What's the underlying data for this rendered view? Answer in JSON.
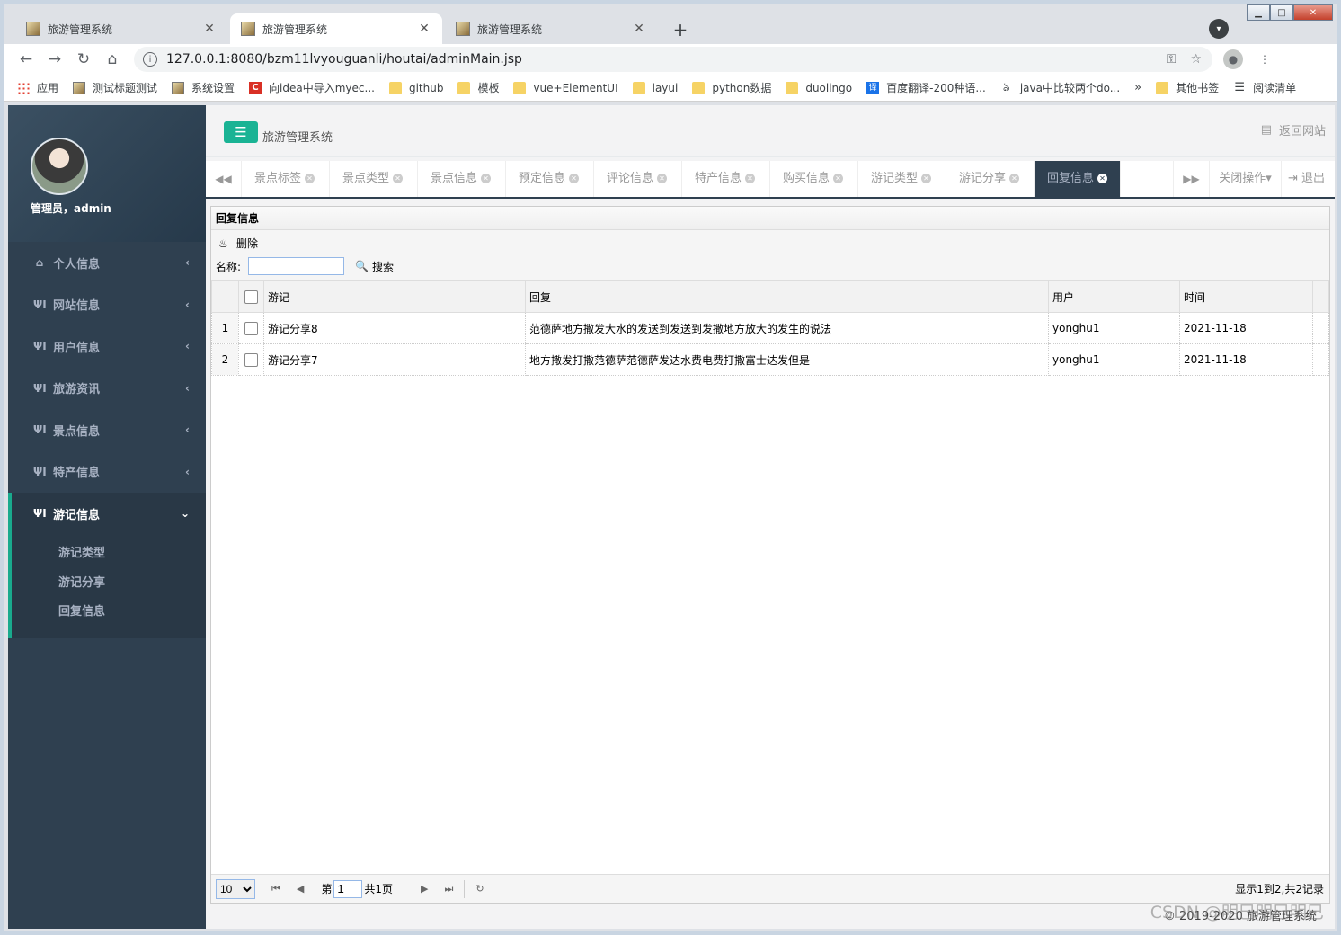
{
  "browser": {
    "tabs": [
      {
        "title": "旅游管理系统",
        "active": false
      },
      {
        "title": "旅游管理系统",
        "active": true
      },
      {
        "title": "旅游管理系统",
        "active": false
      }
    ],
    "url": "127.0.0.1:8080/bzm11lvyouguanli/houtai/adminMain.jsp",
    "bookmarks": [
      {
        "label": "应用",
        "icon": "apps-icon"
      },
      {
        "label": "测试标题测试",
        "icon": "page-icon"
      },
      {
        "label": "系统设置",
        "icon": "page-icon"
      },
      {
        "label": "向idea中导入myec...",
        "icon": "red-c-icon"
      },
      {
        "label": "github",
        "icon": "folder-icon"
      },
      {
        "label": "模板",
        "icon": "folder-icon"
      },
      {
        "label": "vue+ElementUI",
        "icon": "folder-icon"
      },
      {
        "label": "layui",
        "icon": "folder-icon"
      },
      {
        "label": "python数据",
        "icon": "folder-icon"
      },
      {
        "label": "duolingo",
        "icon": "folder-icon"
      },
      {
        "label": "百度翻译-200种语...",
        "icon": "translate-icon"
      },
      {
        "label": "java中比较两个do...",
        "icon": "link-icon"
      }
    ],
    "bookmarks_more": "»",
    "other_bookmarks": "其他书签",
    "reading_list": "阅读清单"
  },
  "sidebar": {
    "user": "管理员，admin",
    "menu": [
      {
        "label": "个人信息",
        "icon": "home-icon"
      },
      {
        "label": "网站信息",
        "icon": "cutlery-icon"
      },
      {
        "label": "用户信息",
        "icon": "cutlery-icon"
      },
      {
        "label": "旅游资讯",
        "icon": "cutlery-icon"
      },
      {
        "label": "景点信息",
        "icon": "cutlery-icon"
      },
      {
        "label": "特产信息",
        "icon": "cutlery-icon"
      },
      {
        "label": "游记信息",
        "icon": "cutlery-icon",
        "open": true
      }
    ],
    "submenu": [
      "游记类型",
      "游记分享",
      "回复信息"
    ]
  },
  "header": {
    "system_title": "旅游管理系统",
    "back_to_site": "返回网站"
  },
  "content_tabs": [
    {
      "label": "景点标签"
    },
    {
      "label": "景点类型"
    },
    {
      "label": "景点信息"
    },
    {
      "label": "预定信息"
    },
    {
      "label": "评论信息"
    },
    {
      "label": "特产信息"
    },
    {
      "label": "购买信息"
    },
    {
      "label": "游记类型"
    },
    {
      "label": "游记分享"
    },
    {
      "label": "回复信息",
      "active": true
    }
  ],
  "tab_actions": {
    "close_ops": "关闭操作",
    "logout": "退出"
  },
  "panel": {
    "title": "回复信息",
    "delete_label": "删除",
    "name_label": "名称:",
    "name_value": "",
    "search_label": "搜索"
  },
  "table": {
    "columns": [
      "游记",
      "回复",
      "用户",
      "时间"
    ],
    "rows": [
      {
        "no": "1",
        "travel_note": "游记分享8",
        "reply": "范德萨地方撒发大水的发送到发送到发撒地方放大的发生的说法",
        "user": "yonghu1",
        "time": "2021-11-18"
      },
      {
        "no": "2",
        "travel_note": "游记分享7",
        "reply": "地方撒发打撒范德萨范德萨发达水费电费打撒富士达发但是",
        "user": "yonghu1",
        "time": "2021-11-18"
      }
    ]
  },
  "pager": {
    "page_size": "10",
    "page_prefix": "第",
    "page_value": "1",
    "page_total": "共1页",
    "info": "显示1到2,共2记录"
  },
  "footer": "© 2019-2020 旅游管理系统",
  "watermark": "CSDN @明巳明巳明巳",
  "colors": {
    "sidebar": "#2f4050",
    "accent": "#1ab394"
  }
}
